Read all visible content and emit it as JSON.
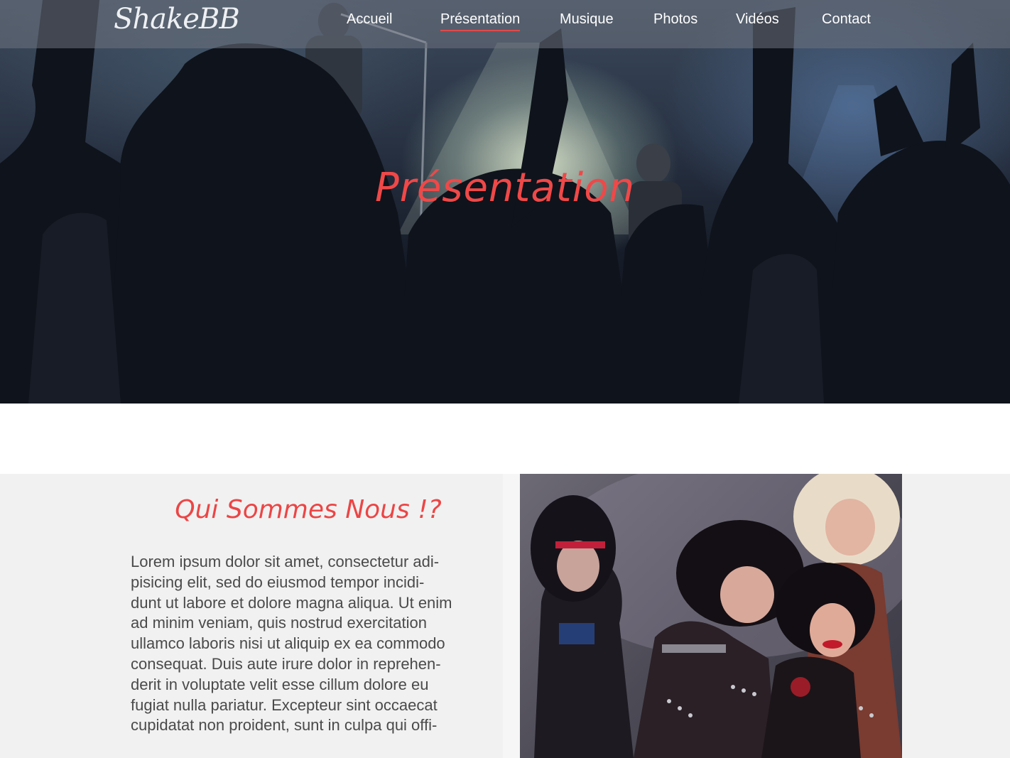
{
  "brand": {
    "logo": "ShakeBB"
  },
  "nav": {
    "items": [
      {
        "label": "Accueil"
      },
      {
        "label": "Présentation",
        "active": true
      },
      {
        "label": "Musique"
      },
      {
        "label": "Photos"
      },
      {
        "label": "Vidéos"
      },
      {
        "label": "Contact"
      }
    ]
  },
  "hero": {
    "title": "Présentation"
  },
  "about": {
    "heading": "Qui Sommes Nous !?",
    "lines": [
      "Lorem ipsum dolor sit amet, consectetur adi-",
      "pisicing elit, sed do eiusmod tempor incidi-",
      "dunt ut labore et dolore magna aliqua. Ut enim",
      "ad minim veniam, quis nostrud exercitation",
      "ullamco laboris nisi ut aliquip ex ea commodo",
      "consequat. Duis aute irure dolor in reprehen-",
      "derit in voluptate velit esse cillum dolore eu",
      "fugiat nulla pariatur. Excepteur sint occaecat",
      "cupidatat non proident, sunt in culpa qui offi-"
    ]
  },
  "colors": {
    "accent": "#ec4545",
    "nav_bg": "#6e737d",
    "section_bg": "#f1f1f1",
    "text": "#4a4a4a"
  }
}
